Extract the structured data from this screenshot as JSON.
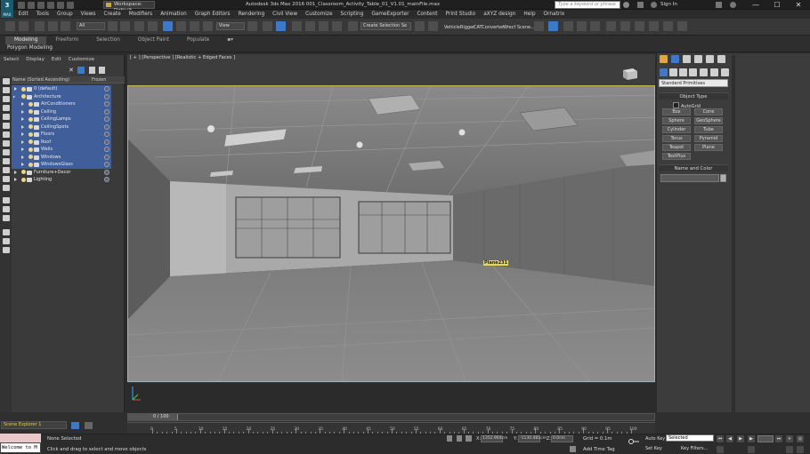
{
  "app": {
    "logo_text": "MAX",
    "workspace_label": "Workspace: Default",
    "window_title": "Autodesk 3ds Max 2016    001_Classroom_Activity_Table_01_V1.01_mainFile.max",
    "search_placeholder": "Type a keyword or phrase",
    "sign_in": "Sign In",
    "min": "—",
    "max": "☐",
    "close": "✕"
  },
  "menu": [
    "Edit",
    "Tools",
    "Group",
    "Views",
    "Create",
    "Modifiers",
    "Animation",
    "Graph Editors",
    "Rendering",
    "Civil View",
    "Customize",
    "Scripting",
    "GameExporter",
    "Content",
    "Print Studio",
    "aXYZ design",
    "Help",
    "Ornatrix"
  ],
  "toolbar": {
    "selection_filter": "All",
    "view_dropdown": "View",
    "named_selection": "Create Selection Se",
    "plugin_1": "VehicleRigger",
    "plugin_2": "CATConverter",
    "plugin_3": "Wrecf Scene..."
  },
  "ribbon": {
    "tabs": [
      "Modeling",
      "Freeform",
      "Selection",
      "Object Paint",
      "Populate"
    ],
    "subtab": "Polygon Modeling"
  },
  "scene_explorer": {
    "menu": [
      "Select",
      "Display",
      "Edit",
      "Customize"
    ],
    "col_name": "Name (Sorted Ascending)",
    "col_frozen": "Frozen",
    "rows": [
      {
        "label": "0 (default)"
      },
      {
        "label": "Architecture"
      },
      {
        "label": "AirConditioners"
      },
      {
        "label": "Ceiling"
      },
      {
        "label": "CeilingLamps"
      },
      {
        "label": "CeilingSpots"
      },
      {
        "label": "Floors"
      },
      {
        "label": "Roof"
      },
      {
        "label": "Walls"
      },
      {
        "label": "Windows"
      },
      {
        "label": "WindowsGlass"
      },
      {
        "label": "Furniture+Decor"
      },
      {
        "label": "Lighting"
      }
    ],
    "selector": "Scene Explorer 1"
  },
  "viewport": {
    "label": "[ + ] [Perspective ] [Realistic + Edged Faces ]",
    "hover_label": "Plane231"
  },
  "command_panel": {
    "dropdown": "Standard Primitives",
    "object_type_header": "Object Type",
    "autogrid": "AutoGrid",
    "buttons": [
      "Box",
      "Cone",
      "Sphere",
      "GeoSphere",
      "Cylinder",
      "Tube",
      "Torus",
      "Pyramid",
      "Teapot",
      "Plane",
      "TextPlus"
    ],
    "name_color_header": "Name and Color"
  },
  "timeline": {
    "frame_text": "0 / 100",
    "ticks": [
      "0",
      "5",
      "10",
      "15",
      "20",
      "25",
      "30",
      "35",
      "40",
      "45",
      "50",
      "55",
      "60",
      "65",
      "70",
      "75",
      "80",
      "85",
      "90",
      "95",
      "100"
    ]
  },
  "status": {
    "listener_text": "Welcome to M",
    "selected": "None Selected",
    "prompt": "Click and drag to select and move objects",
    "x_label": "X:",
    "x_value": "1352.964cm",
    "y_label": "Y:",
    "y_value": "-1130.481cm",
    "z_label": "Z:",
    "z_value": "0.0cm",
    "grid": "Grid = 0.1m",
    "add_time_tag": "Add Time Tag",
    "auto_key": "Auto Key",
    "set_key": "Set Key",
    "selected_dropdown": "Selected",
    "key_filters": "Key Filters..."
  }
}
